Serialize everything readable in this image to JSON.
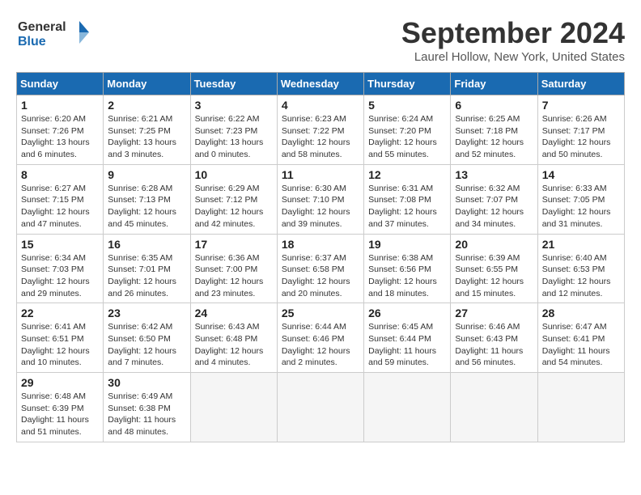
{
  "header": {
    "logo_line1": "General",
    "logo_line2": "Blue",
    "month": "September 2024",
    "location": "Laurel Hollow, New York, United States"
  },
  "weekdays": [
    "Sunday",
    "Monday",
    "Tuesday",
    "Wednesday",
    "Thursday",
    "Friday",
    "Saturday"
  ],
  "weeks": [
    [
      {
        "day": "1",
        "info": "Sunrise: 6:20 AM\nSunset: 7:26 PM\nDaylight: 13 hours\nand 6 minutes."
      },
      {
        "day": "2",
        "info": "Sunrise: 6:21 AM\nSunset: 7:25 PM\nDaylight: 13 hours\nand 3 minutes."
      },
      {
        "day": "3",
        "info": "Sunrise: 6:22 AM\nSunset: 7:23 PM\nDaylight: 13 hours\nand 0 minutes."
      },
      {
        "day": "4",
        "info": "Sunrise: 6:23 AM\nSunset: 7:22 PM\nDaylight: 12 hours\nand 58 minutes."
      },
      {
        "day": "5",
        "info": "Sunrise: 6:24 AM\nSunset: 7:20 PM\nDaylight: 12 hours\nand 55 minutes."
      },
      {
        "day": "6",
        "info": "Sunrise: 6:25 AM\nSunset: 7:18 PM\nDaylight: 12 hours\nand 52 minutes."
      },
      {
        "day": "7",
        "info": "Sunrise: 6:26 AM\nSunset: 7:17 PM\nDaylight: 12 hours\nand 50 minutes."
      }
    ],
    [
      {
        "day": "8",
        "info": "Sunrise: 6:27 AM\nSunset: 7:15 PM\nDaylight: 12 hours\nand 47 minutes."
      },
      {
        "day": "9",
        "info": "Sunrise: 6:28 AM\nSunset: 7:13 PM\nDaylight: 12 hours\nand 45 minutes."
      },
      {
        "day": "10",
        "info": "Sunrise: 6:29 AM\nSunset: 7:12 PM\nDaylight: 12 hours\nand 42 minutes."
      },
      {
        "day": "11",
        "info": "Sunrise: 6:30 AM\nSunset: 7:10 PM\nDaylight: 12 hours\nand 39 minutes."
      },
      {
        "day": "12",
        "info": "Sunrise: 6:31 AM\nSunset: 7:08 PM\nDaylight: 12 hours\nand 37 minutes."
      },
      {
        "day": "13",
        "info": "Sunrise: 6:32 AM\nSunset: 7:07 PM\nDaylight: 12 hours\nand 34 minutes."
      },
      {
        "day": "14",
        "info": "Sunrise: 6:33 AM\nSunset: 7:05 PM\nDaylight: 12 hours\nand 31 minutes."
      }
    ],
    [
      {
        "day": "15",
        "info": "Sunrise: 6:34 AM\nSunset: 7:03 PM\nDaylight: 12 hours\nand 29 minutes."
      },
      {
        "day": "16",
        "info": "Sunrise: 6:35 AM\nSunset: 7:01 PM\nDaylight: 12 hours\nand 26 minutes."
      },
      {
        "day": "17",
        "info": "Sunrise: 6:36 AM\nSunset: 7:00 PM\nDaylight: 12 hours\nand 23 minutes."
      },
      {
        "day": "18",
        "info": "Sunrise: 6:37 AM\nSunset: 6:58 PM\nDaylight: 12 hours\nand 20 minutes."
      },
      {
        "day": "19",
        "info": "Sunrise: 6:38 AM\nSunset: 6:56 PM\nDaylight: 12 hours\nand 18 minutes."
      },
      {
        "day": "20",
        "info": "Sunrise: 6:39 AM\nSunset: 6:55 PM\nDaylight: 12 hours\nand 15 minutes."
      },
      {
        "day": "21",
        "info": "Sunrise: 6:40 AM\nSunset: 6:53 PM\nDaylight: 12 hours\nand 12 minutes."
      }
    ],
    [
      {
        "day": "22",
        "info": "Sunrise: 6:41 AM\nSunset: 6:51 PM\nDaylight: 12 hours\nand 10 minutes."
      },
      {
        "day": "23",
        "info": "Sunrise: 6:42 AM\nSunset: 6:50 PM\nDaylight: 12 hours\nand 7 minutes."
      },
      {
        "day": "24",
        "info": "Sunrise: 6:43 AM\nSunset: 6:48 PM\nDaylight: 12 hours\nand 4 minutes."
      },
      {
        "day": "25",
        "info": "Sunrise: 6:44 AM\nSunset: 6:46 PM\nDaylight: 12 hours\nand 2 minutes."
      },
      {
        "day": "26",
        "info": "Sunrise: 6:45 AM\nSunset: 6:44 PM\nDaylight: 11 hours\nand 59 minutes."
      },
      {
        "day": "27",
        "info": "Sunrise: 6:46 AM\nSunset: 6:43 PM\nDaylight: 11 hours\nand 56 minutes."
      },
      {
        "day": "28",
        "info": "Sunrise: 6:47 AM\nSunset: 6:41 PM\nDaylight: 11 hours\nand 54 minutes."
      }
    ],
    [
      {
        "day": "29",
        "info": "Sunrise: 6:48 AM\nSunset: 6:39 PM\nDaylight: 11 hours\nand 51 minutes."
      },
      {
        "day": "30",
        "info": "Sunrise: 6:49 AM\nSunset: 6:38 PM\nDaylight: 11 hours\nand 48 minutes."
      },
      {
        "day": "",
        "info": ""
      },
      {
        "day": "",
        "info": ""
      },
      {
        "day": "",
        "info": ""
      },
      {
        "day": "",
        "info": ""
      },
      {
        "day": "",
        "info": ""
      }
    ]
  ]
}
